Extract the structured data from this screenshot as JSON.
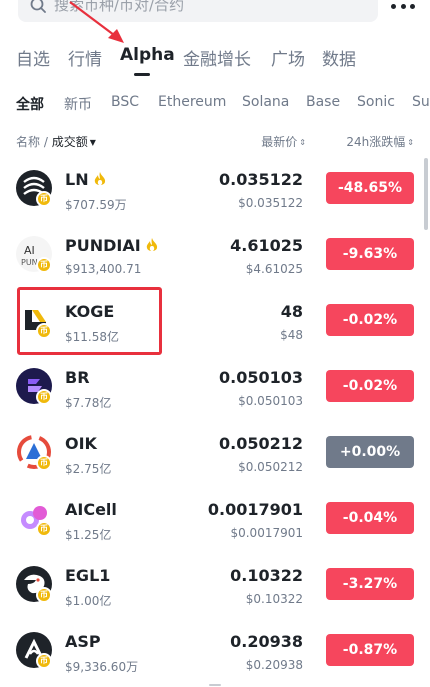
{
  "search": {
    "placeholder": "搜索币种/币对/合约",
    "icon": "search-icon"
  },
  "header": {
    "more_icon": "more-icon"
  },
  "main_tabs": [
    {
      "label": "自选",
      "active": false
    },
    {
      "label": "行情",
      "active": false
    },
    {
      "label": "Alpha",
      "active": true
    },
    {
      "label": "金融增长",
      "active": false
    },
    {
      "label": "广场",
      "active": false
    },
    {
      "label": "数据",
      "active": false
    }
  ],
  "chain_tabs": [
    {
      "label": "全部",
      "active": true
    },
    {
      "label": "新币",
      "active": false
    },
    {
      "label": "BSC",
      "active": false
    },
    {
      "label": "Ethereum",
      "active": false
    },
    {
      "label": "Solana",
      "active": false
    },
    {
      "label": "Base",
      "active": false
    },
    {
      "label": "Sonic",
      "active": false
    },
    {
      "label": "Su",
      "active": false
    }
  ],
  "columns": {
    "name": "名称",
    "separator": " / ",
    "volume": "成交额",
    "price": "最新价",
    "change": "24h涨跌幅"
  },
  "colors": {
    "down": "#f6465d",
    "flat": "#707a8a",
    "accent": "#f0b90b",
    "highlight": "#e8303d",
    "arrow": "#e8303d"
  },
  "tokens": [
    {
      "symbol": "LN",
      "hot": true,
      "volume": "$707.59万",
      "price": "0.035122",
      "price_sub": "$0.035122",
      "change": "-48.65%",
      "trend": "down",
      "icon": "ln-token-icon"
    },
    {
      "symbol": "PUNDIAI",
      "hot": true,
      "volume": "$913,400.71",
      "price": "4.61025",
      "price_sub": "$4.61025",
      "change": "-9.63%",
      "trend": "down",
      "icon": "pundiai-token-icon",
      "icon_text": "AI",
      "icon_sub": "PUN"
    },
    {
      "symbol": "KOGE",
      "hot": false,
      "volume": "$11.58亿",
      "price": "48",
      "price_sub": "$48",
      "change": "-0.02%",
      "trend": "down",
      "icon": "koge-token-icon"
    },
    {
      "symbol": "BR",
      "hot": false,
      "volume": "$7.78亿",
      "price": "0.050103",
      "price_sub": "$0.050103",
      "change": "-0.02%",
      "trend": "down",
      "icon": "br-token-icon"
    },
    {
      "symbol": "OIK",
      "hot": false,
      "volume": "$2.75亿",
      "price": "0.050212",
      "price_sub": "$0.050212",
      "change": "+0.00%",
      "trend": "flat",
      "icon": "oik-token-icon"
    },
    {
      "symbol": "AICell",
      "hot": false,
      "volume": "$1.25亿",
      "price": "0.0017901",
      "price_sub": "$0.0017901",
      "change": "-0.04%",
      "trend": "down",
      "icon": "aicell-token-icon"
    },
    {
      "symbol": "EGL1",
      "hot": false,
      "volume": "$1.00亿",
      "price": "0.10322",
      "price_sub": "$0.10322",
      "change": "-3.27%",
      "trend": "down",
      "icon": "egl1-token-icon"
    },
    {
      "symbol": "ASP",
      "hot": false,
      "volume": "$9,336.60万",
      "price": "0.20938",
      "price_sub": "$0.20938",
      "change": "-0.87%",
      "trend": "down",
      "icon": "asp-token-icon"
    }
  ]
}
